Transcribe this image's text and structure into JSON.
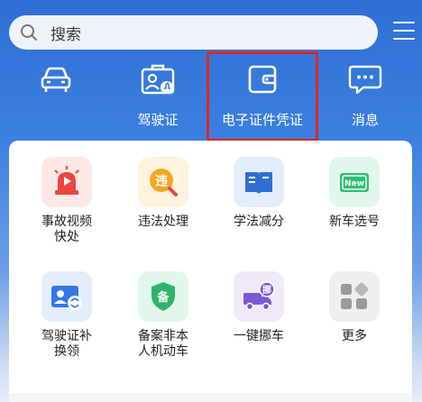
{
  "search": {
    "placeholder": "搜索"
  },
  "quick_nav": [
    {
      "label": "",
      "icon": "car-icon"
    },
    {
      "label": "驾驶证",
      "icon": "license-icon"
    },
    {
      "label": "电子证件凭证",
      "icon": "wallet-icon"
    },
    {
      "label": "消息",
      "icon": "message-icon"
    }
  ],
  "services": [
    {
      "label_line1": "事故视频",
      "label_line2": "快处",
      "icon": "siren-icon",
      "color": "#e9473f"
    },
    {
      "label_line1": "违法处理",
      "label_line2": "",
      "icon": "violation-badge-icon",
      "badge": "违",
      "color": "#f5a623"
    },
    {
      "label_line1": "学法减分",
      "label_line2": "",
      "icon": "book-icon",
      "color": "#2f6fd3"
    },
    {
      "label_line1": "新车选号",
      "label_line2": "",
      "icon": "new-plate-icon",
      "badge": "New",
      "color": "#2fbf71"
    },
    {
      "label_line1": "驾驶证补",
      "label_line2": "换领",
      "icon": "id-card-icon",
      "color": "#3478e5"
    },
    {
      "label_line1": "备案非本",
      "label_line2": "人机动车",
      "icon": "shield-icon",
      "badge": "备",
      "color": "#30b36b"
    },
    {
      "label_line1": "一键挪车",
      "label_line2": "",
      "icon": "tow-truck-icon",
      "badge": "挪",
      "color": "#7b59d6"
    },
    {
      "label_line1": "更多",
      "label_line2": "",
      "icon": "more-apps-icon",
      "color": "#9a9a9a"
    }
  ]
}
